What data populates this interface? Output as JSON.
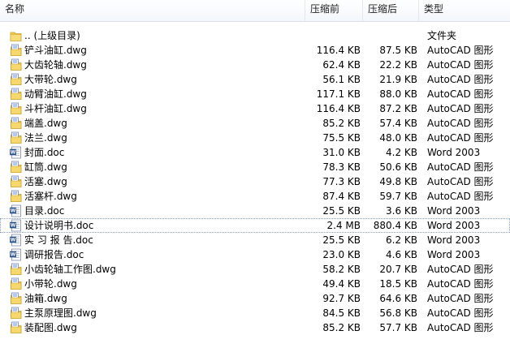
{
  "columns": {
    "name": "名称",
    "compressed": "压缩前",
    "after": "压缩后",
    "type": "类型"
  },
  "files": [
    {
      "name": ".. (上级目录)",
      "compressed": "",
      "after": "",
      "type": "文件夹",
      "icon": "folder-icon"
    },
    {
      "name": "铲斗油缸.dwg",
      "compressed": "116.4 KB",
      "after": "87.5 KB",
      "type": "AutoCAD 图形",
      "icon": "dwg-file-icon"
    },
    {
      "name": "大齿轮轴.dwg",
      "compressed": "62.4 KB",
      "after": "22.2 KB",
      "type": "AutoCAD 图形",
      "icon": "dwg-file-icon"
    },
    {
      "name": "大带轮.dwg",
      "compressed": "56.1 KB",
      "after": "21.9 KB",
      "type": "AutoCAD 图形",
      "icon": "dwg-file-icon"
    },
    {
      "name": "动臂油缸.dwg",
      "compressed": "117.1 KB",
      "after": "88.0 KB",
      "type": "AutoCAD 图形",
      "icon": "dwg-file-icon"
    },
    {
      "name": "斗杆油缸.dwg",
      "compressed": "116.4 KB",
      "after": "87.2 KB",
      "type": "AutoCAD 图形",
      "icon": "dwg-file-icon"
    },
    {
      "name": "端盖.dwg",
      "compressed": "85.2 KB",
      "after": "57.4 KB",
      "type": "AutoCAD 图形",
      "icon": "dwg-file-icon"
    },
    {
      "name": "法兰.dwg",
      "compressed": "75.5 KB",
      "after": "48.0 KB",
      "type": "AutoCAD 图形",
      "icon": "dwg-file-icon"
    },
    {
      "name": "封面.doc",
      "compressed": "31.0 KB",
      "after": "4.2 KB",
      "type": "Word 2003",
      "icon": "word-doc-icon"
    },
    {
      "name": "缸筒.dwg",
      "compressed": "78.3 KB",
      "after": "50.6 KB",
      "type": "AutoCAD 图形",
      "icon": "dwg-file-icon"
    },
    {
      "name": "活塞.dwg",
      "compressed": "77.3 KB",
      "after": "49.8 KB",
      "type": "AutoCAD 图形",
      "icon": "dwg-file-icon"
    },
    {
      "name": "活塞杆.dwg",
      "compressed": "87.4 KB",
      "after": "59.7 KB",
      "type": "AutoCAD 图形",
      "icon": "dwg-file-icon"
    },
    {
      "name": "目录.doc",
      "compressed": "25.5 KB",
      "after": "3.6 KB",
      "type": "Word 2003",
      "icon": "word-doc-icon"
    },
    {
      "name": "设计说明书.doc",
      "compressed": "2.4 MB",
      "after": "880.4 KB",
      "type": "Word 2003",
      "icon": "word-doc-icon",
      "selected": true
    },
    {
      "name": "实 习 报 告.doc",
      "compressed": "25.5 KB",
      "after": "6.2 KB",
      "type": "Word 2003",
      "icon": "word-doc-icon"
    },
    {
      "name": "调研报告.doc",
      "compressed": "23.0 KB",
      "after": "4.6 KB",
      "type": "Word 2003",
      "icon": "word-doc-icon"
    },
    {
      "name": "小齿轮轴工作图.dwg",
      "compressed": "58.2 KB",
      "after": "20.7 KB",
      "type": "AutoCAD 图形",
      "icon": "dwg-file-icon"
    },
    {
      "name": "小带轮.dwg",
      "compressed": "49.4 KB",
      "after": "18.5 KB",
      "type": "AutoCAD 图形",
      "icon": "dwg-file-icon"
    },
    {
      "name": "油箱.dwg",
      "compressed": "92.7 KB",
      "after": "64.6 KB",
      "type": "AutoCAD 图形",
      "icon": "dwg-file-icon"
    },
    {
      "name": "主泵原理图.dwg",
      "compressed": "84.5 KB",
      "after": "56.8 KB",
      "type": "AutoCAD 图形",
      "icon": "dwg-file-icon"
    },
    {
      "name": "装配图.dwg",
      "compressed": "85.2 KB",
      "after": "57.7 KB",
      "type": "AutoCAD 图形",
      "icon": "dwg-file-icon"
    }
  ]
}
